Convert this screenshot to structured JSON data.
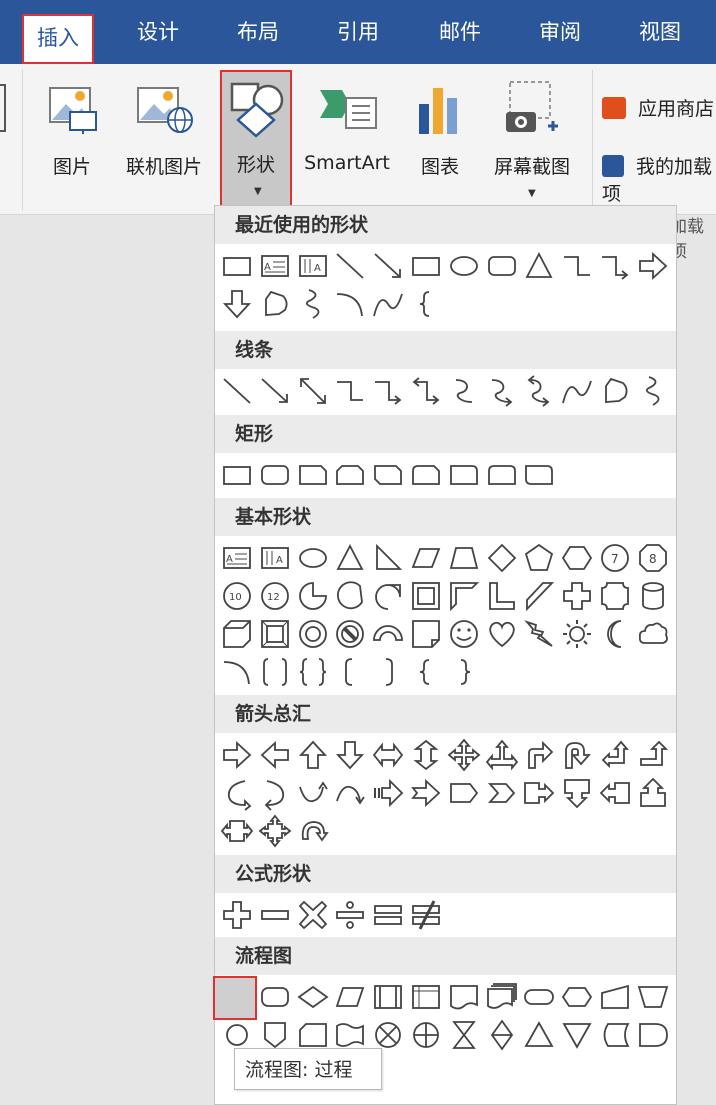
{
  "tabs": [
    {
      "label": "插入",
      "active": true
    },
    {
      "label": "设计"
    },
    {
      "label": "布局"
    },
    {
      "label": "引用"
    },
    {
      "label": "邮件"
    },
    {
      "label": "审阅"
    },
    {
      "label": "视图"
    }
  ],
  "ribbon": {
    "picture": "图片",
    "online_picture": "联机图片",
    "shapes": "形状",
    "smartart": "SmartArt",
    "chart": "图表",
    "screenshot": "屏幕截图",
    "app_store": "应用商店",
    "my_addins": "我的加载项",
    "addins_group": "加载项"
  },
  "shapes_menu": {
    "sections": [
      {
        "title": "最近使用的形状",
        "shapes": [
          "rect",
          "textbox",
          "vtextbox",
          "line",
          "arrowline",
          "rect",
          "oval",
          "roundrect",
          "triangle",
          "elbow",
          "elbowarrow",
          "rightarrow",
          "downarrow",
          "freeform",
          "scribble",
          "arc",
          "curve",
          "lbrace"
        ]
      },
      {
        "title": "线条",
        "shapes": [
          "line",
          "arrowline",
          "dblarrowline",
          "elbow",
          "elbowarrow",
          "dblelbow",
          "curveconn",
          "curvearrow",
          "dblcurve",
          "curve",
          "freeform",
          "scribble"
        ]
      },
      {
        "title": "矩形",
        "shapes": [
          "rect",
          "roundrect",
          "snip1",
          "snip2",
          "snipdiag",
          "sniprounded",
          "round1",
          "round2",
          "rounddiag"
        ]
      },
      {
        "title": "基本形状",
        "shapes": [
          "textbox",
          "vtextbox",
          "oval",
          "triangle",
          "rtriangle",
          "parallelogram",
          "trapezoid",
          "diamond",
          "pentagon",
          "hexagon",
          "heptagon",
          "octagon",
          "decagon",
          "dodecagon",
          "pie",
          "chord",
          "teardrop",
          "frame",
          "halfframe",
          "lshape",
          "diagstripe",
          "cross",
          "plaque",
          "can",
          "cube",
          "bevel",
          "donut",
          "nosymbol",
          "blockarc",
          "foldedcorner",
          "smiley",
          "heart",
          "lightning",
          "sun",
          "moon",
          "cloud",
          "arc",
          "dblbracket",
          "dblbrace",
          "lbracket",
          "rbracket",
          "lbrace",
          "rbrace"
        ]
      },
      {
        "title": "箭头总汇",
        "shapes": [
          "rightarrow",
          "leftarrow",
          "uparrow",
          "downarrow",
          "lrarrow",
          "udarrow",
          "quadarrow",
          "lrudarrow",
          "bentarrow",
          "uturnarrow",
          "leftuparrow",
          "bentuparrow",
          "curvedright",
          "curvedleft",
          "curvedup",
          "curveddown",
          "stripedright",
          "notchedright",
          "pentarrow",
          "chevron",
          "rightcallout",
          "downcallout",
          "leftcallout",
          "upcallout",
          "lrcallout",
          "quadcallout",
          "circulararrow"
        ]
      },
      {
        "title": "公式形状",
        "shapes": [
          "plus",
          "minus",
          "multiply",
          "divide",
          "equal",
          "notequal"
        ]
      },
      {
        "title": "流程图",
        "shapes": [
          "process",
          "altprocess",
          "decision",
          "data",
          "predefined",
          "internal",
          "document",
          "multidoc",
          "terminator",
          "preparation",
          "manualinput",
          "manualop",
          "connector",
          "offpage",
          "card",
          "punchtape",
          "summing",
          "or",
          "collate",
          "sort",
          "extract",
          "merge",
          "storeddata",
          "delay"
        ]
      }
    ],
    "tooltip": "流程图: 过程"
  },
  "colors": {
    "accent": "#2b579a",
    "highlight": "#e03030"
  }
}
